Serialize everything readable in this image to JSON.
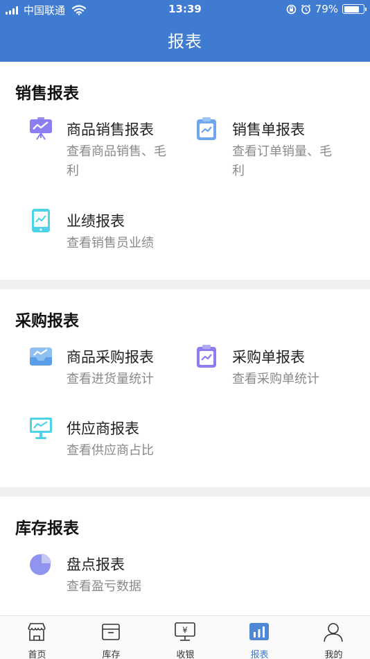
{
  "status_bar": {
    "carrier": "中国联通",
    "time": "13:39",
    "battery": "79%",
    "battery_level": 0.79
  },
  "header": {
    "title": "报表"
  },
  "sections": [
    {
      "title": "销售报表",
      "items": [
        {
          "title": "商品销售报表",
          "desc": "查看商品销售、毛利",
          "icon": "presentation-chart-icon"
        },
        {
          "title": "销售单报表",
          "desc": "查看订单销量、毛利",
          "icon": "clipboard-chart-icon"
        },
        {
          "title": "业绩报表",
          "desc": "查看销售员业绩",
          "icon": "tablet-chart-icon"
        }
      ]
    },
    {
      "title": "采购报表",
      "items": [
        {
          "title": "商品采购报表",
          "desc": "查看进货量统计",
          "icon": "tray-chart-icon"
        },
        {
          "title": "采购单报表",
          "desc": "查看采购单统计",
          "icon": "clipboard-chart-icon"
        },
        {
          "title": "供应商报表",
          "desc": "查看供应商占比",
          "icon": "monitor-chart-icon"
        }
      ]
    },
    {
      "title": "库存报表",
      "items": [
        {
          "title": "盘点报表",
          "desc": "查看盈亏数据",
          "icon": "pie-chart-icon"
        }
      ]
    }
  ],
  "tabbar": [
    {
      "label": "首页",
      "icon": "store-icon"
    },
    {
      "label": "库存",
      "icon": "box-icon"
    },
    {
      "label": "收银",
      "icon": "cashier-monitor-icon"
    },
    {
      "label": "报表",
      "icon": "bar-chart-icon",
      "active": true
    },
    {
      "label": "我的",
      "icon": "user-icon"
    }
  ],
  "colors": {
    "header_bg": "#3f7bd0",
    "active_tab": "#3f7bd0"
  }
}
